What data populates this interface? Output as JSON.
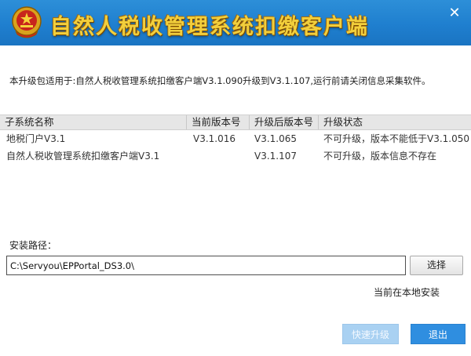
{
  "window": {
    "title": "自然人税收管理系统扣缴客户端",
    "close_glyph": "✕",
    "accent_color": "#1f7fcf",
    "title_color": "#f2cf3c"
  },
  "notice": "本升级包适用于:自然人税收管理系统扣缴客户端V3.1.090升级到V3.1.107,运行前请关闭信息采集软件。",
  "table": {
    "headers": [
      "子系统名称",
      "当前版本号",
      "升级后版本号",
      "升级状态"
    ],
    "rows": [
      [
        "地税门户V3.1",
        "V3.1.016",
        "V3.1.065",
        "不可升级，版本不能低于V3.1.050"
      ],
      [
        "自然人税收管理系统扣缴客户端V3.1",
        "",
        "V3.1.107",
        "不可升级，版本信息不存在"
      ]
    ]
  },
  "install": {
    "label": "安装路径：",
    "path_value": "C:\\Servyou\\EPPortal_DS3.0\\",
    "browse_label": "选择",
    "status": "当前在本地安装"
  },
  "buttons": {
    "upgrade": "快速升级",
    "exit": "退出"
  }
}
